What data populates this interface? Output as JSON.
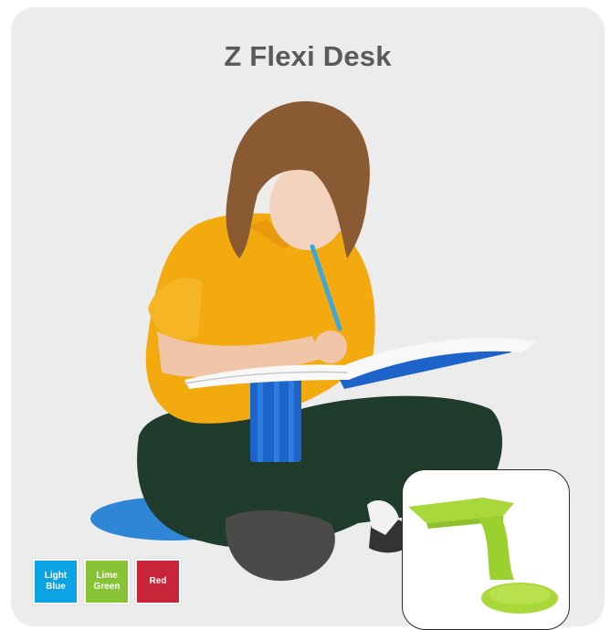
{
  "product": {
    "title": "Z Flexi Desk"
  },
  "colors": [
    {
      "label": "Light Blue",
      "hex": "#0ba3e3"
    },
    {
      "label": "Lime Green",
      "hex": "#86c435"
    },
    {
      "label": "Red",
      "hex": "#c7243a"
    }
  ],
  "thumbnail": {
    "color_name": "Lime Green",
    "color_hex": "#a9d83a"
  }
}
